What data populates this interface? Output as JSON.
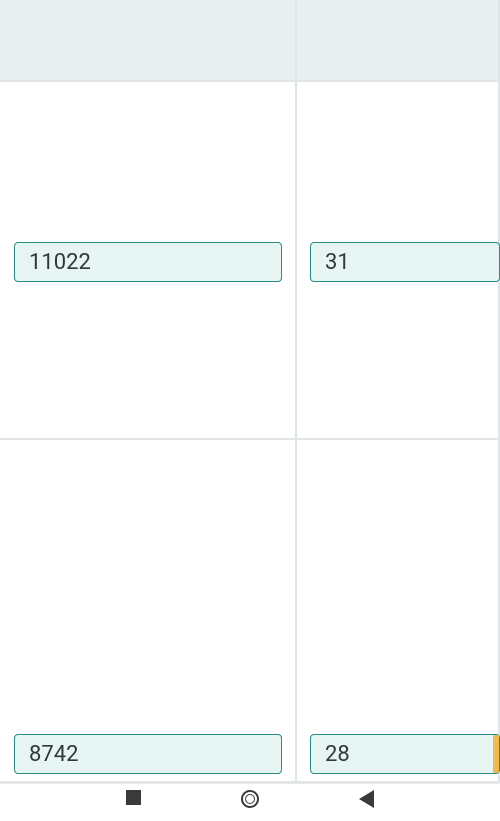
{
  "grid": {
    "rows": [
      {
        "leftValue": "11022",
        "rightValue": "31"
      },
      {
        "leftValue": "8742",
        "rightValue": "28"
      }
    ]
  }
}
